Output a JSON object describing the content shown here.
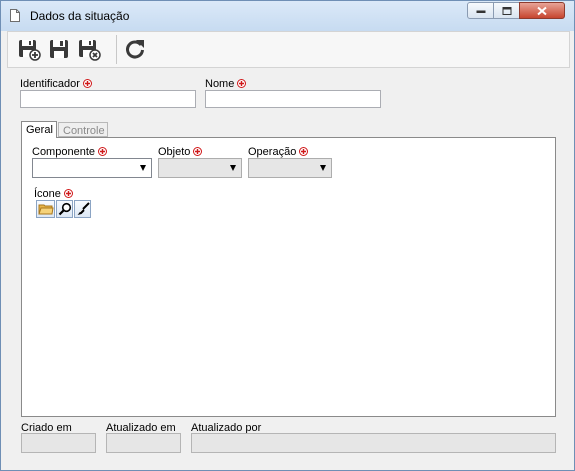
{
  "window": {
    "title": "Dados da situação",
    "controls": [
      "minimize-icon",
      "maximize-icon",
      "close-icon"
    ]
  },
  "toolbar": {
    "buttons": [
      {
        "name": "save-and-new",
        "icon": "save-plus-icon"
      },
      {
        "name": "save",
        "icon": "save-icon"
      },
      {
        "name": "save-and-close",
        "icon": "save-close-icon"
      },
      {
        "name": "refresh",
        "icon": "refresh-icon"
      }
    ]
  },
  "fields": {
    "identificador": {
      "label": "Identificador",
      "value": "",
      "required": true
    },
    "nome": {
      "label": "Nome",
      "value": "",
      "required": true
    }
  },
  "tabs": [
    {
      "label": "Geral",
      "active": true
    },
    {
      "label": "Controle",
      "active": false
    }
  ],
  "geral": {
    "componente": {
      "label": "Componente",
      "value": "",
      "required": true
    },
    "objeto": {
      "label": "Objeto",
      "value": "",
      "required": true
    },
    "operacao": {
      "label": "Operação",
      "value": "",
      "required": true
    },
    "icone": {
      "label": "Ícone",
      "required": true,
      "buttons": [
        "folder-icon",
        "search-icon",
        "clear-brush-icon"
      ]
    }
  },
  "footer": {
    "criado_em": {
      "label": "Criado em",
      "value": ""
    },
    "atualizado_em": {
      "label": "Atualizado em",
      "value": ""
    },
    "atualizado_por": {
      "label": "Atualizado por",
      "value": ""
    }
  },
  "colors": {
    "required_marker": "#d0191a",
    "titlebar": "#c7dbf1",
    "close_button": "#c7452f"
  }
}
